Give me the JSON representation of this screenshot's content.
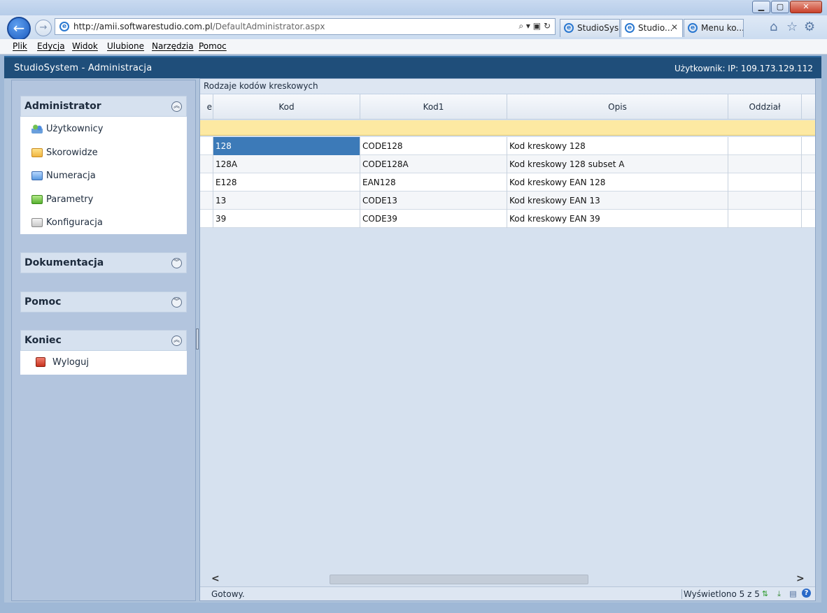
{
  "browser": {
    "url_host": "http://amii.softwarestudio.com.pl",
    "url_path": "/DefaultAdministrator.aspx",
    "tabs": [
      {
        "label": "StudioSys..."
      },
      {
        "label": "Studio..."
      },
      {
        "label": "Menu ko..."
      }
    ],
    "window_controls": {
      "minimize": "▁",
      "maximize": "▢",
      "close": "✕"
    }
  },
  "menubar": [
    "Plik",
    "Edycja",
    "Widok",
    "Ulubione",
    "Narzędzia",
    "Pomoc"
  ],
  "app": {
    "title": "StudioSystem - Administracja",
    "user_info": "Użytkownik: IP: 109.173.129.112"
  },
  "sidebar": {
    "sections": [
      {
        "title": "Administrator",
        "expanded": true,
        "items": [
          {
            "label": "Użytkownicy",
            "icon": "users-icon"
          },
          {
            "label": "Skorowidze",
            "icon": "folder-icon"
          },
          {
            "label": "Numeracja",
            "icon": "folder-icon"
          },
          {
            "label": "Parametry",
            "icon": "folder-icon"
          },
          {
            "label": "Konfiguracja",
            "icon": "folder-icon"
          }
        ]
      },
      {
        "title": "Dokumentacja",
        "expanded": false
      },
      {
        "title": "Pomoc",
        "expanded": false
      },
      {
        "title": "Koniec",
        "expanded": true,
        "items": [
          {
            "label": "Wyloguj",
            "icon": "logout-icon"
          }
        ]
      }
    ]
  },
  "grid": {
    "title": "Rodzaje kodów kreskowych",
    "columns": [
      "e",
      "Kod",
      "Kod1",
      "Opis",
      "Oddział"
    ],
    "rows": [
      {
        "kod": "128",
        "kod1": "CODE128",
        "opis": "Kod kreskowy 128",
        "oddzial": ""
      },
      {
        "kod": "128A",
        "kod1": "CODE128A",
        "opis": "Kod kreskowy 128 subset A",
        "oddzial": ""
      },
      {
        "kod": "E128",
        "kod1": "EAN128",
        "opis": "Kod kreskowy EAN 128",
        "oddzial": ""
      },
      {
        "kod": "13",
        "kod1": "CODE13",
        "opis": "Kod kreskowy EAN 13",
        "oddzial": ""
      },
      {
        "kod": "39",
        "kod1": "CODE39",
        "opis": "Kod kreskowy EAN 39",
        "oddzial": ""
      }
    ],
    "selected_row": 0,
    "status_left": "Gotowy.",
    "status_right": "Wyświetlono 5 z 5"
  },
  "colors": {
    "header_bg": "#1f4e7a",
    "selection": "#3c7ab8",
    "filter_row": "#fde9a2"
  }
}
